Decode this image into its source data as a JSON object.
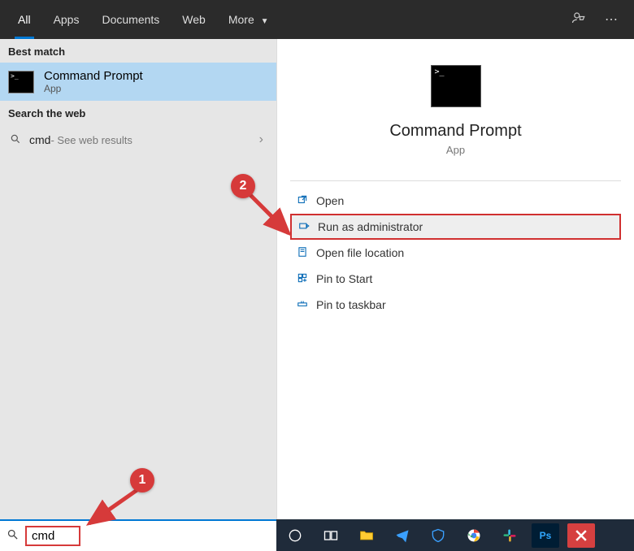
{
  "tabs": {
    "all": "All",
    "apps": "Apps",
    "documents": "Documents",
    "web": "Web",
    "more": "More"
  },
  "sections": {
    "best_match": "Best match",
    "search_web": "Search the web"
  },
  "best_match": {
    "title": "Command Prompt",
    "subtitle": "App"
  },
  "web_result": {
    "term": "cmd",
    "hint": " - See web results"
  },
  "preview": {
    "title": "Command Prompt",
    "subtitle": "App"
  },
  "actions": {
    "open": "Open",
    "run_admin": "Run as administrator",
    "open_loc": "Open file location",
    "pin_start": "Pin to Start",
    "pin_taskbar": "Pin to taskbar"
  },
  "search_input": "cmd",
  "annotations": {
    "a1": "1",
    "a2": "2"
  }
}
